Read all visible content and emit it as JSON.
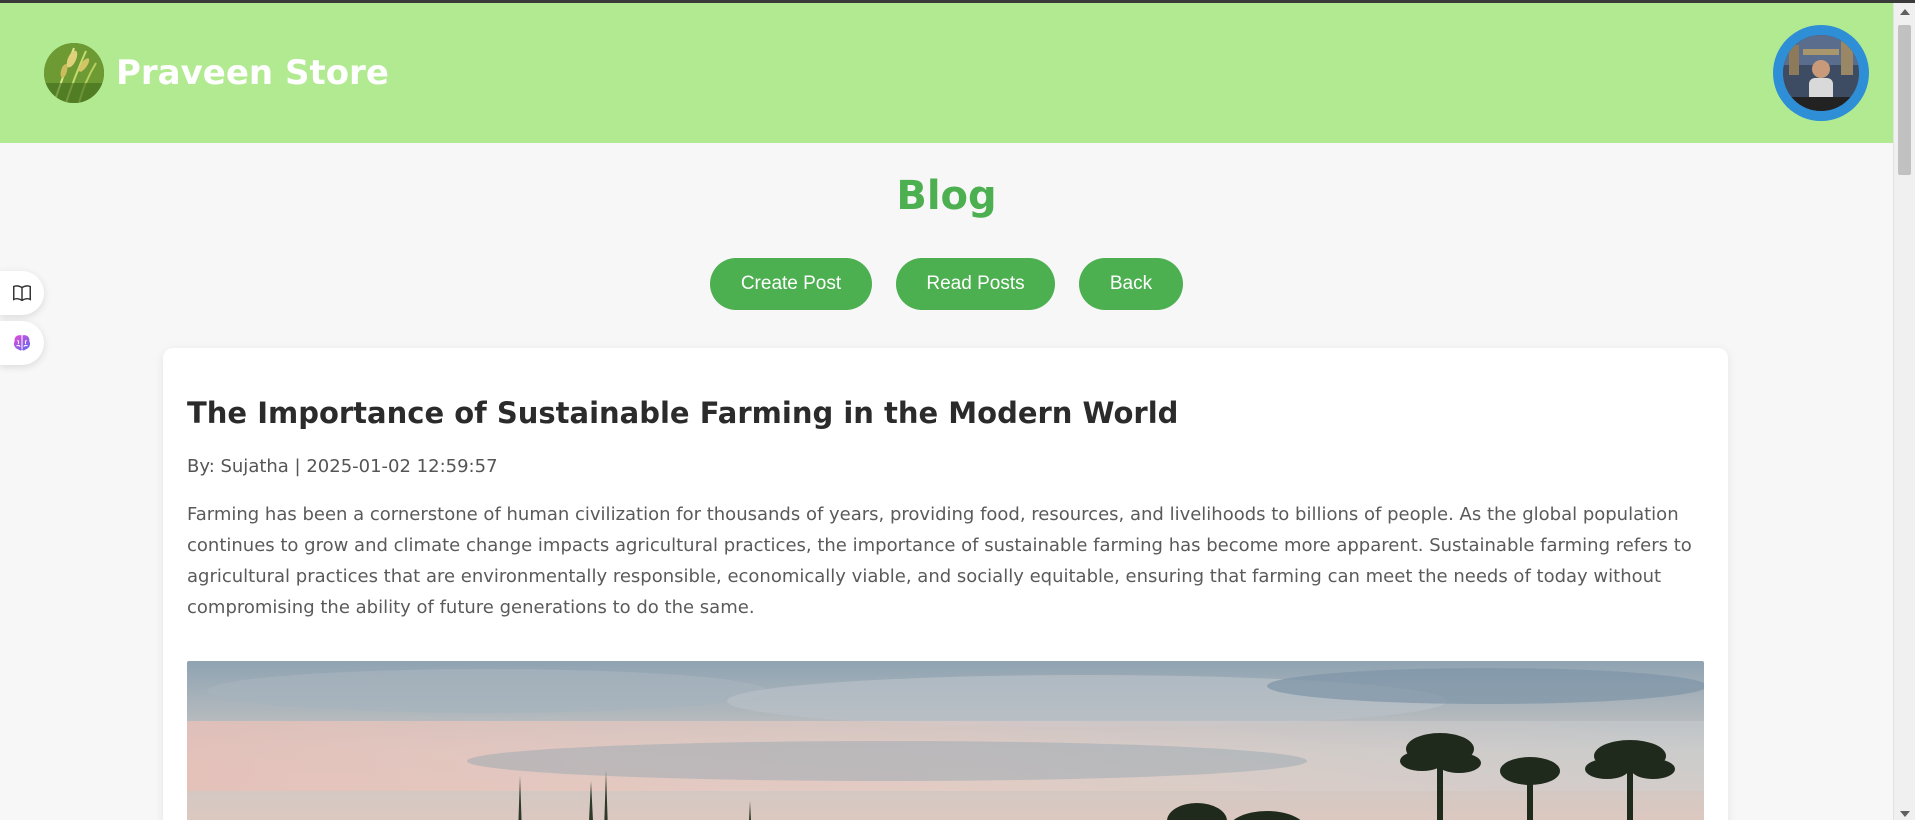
{
  "header": {
    "brand_name": "Praveen Store",
    "logo_icon": "rice-plant-logo",
    "avatar_icon": "user-avatar"
  },
  "page": {
    "title": "Blog"
  },
  "actions": {
    "create_label": "Create Post",
    "read_label": "Read Posts",
    "back_label": "Back"
  },
  "side_tools": [
    {
      "icon": "book-icon"
    },
    {
      "icon": "brain-icon"
    }
  ],
  "post": {
    "title": "The Importance of Sustainable Farming in the Modern World",
    "meta": "By: Sujatha | 2025-01-02 12:59:57",
    "body": "Farming has been a cornerstone of human civilization for thousands of years, providing food, resources, and livelihoods to billions of people. As the global population continues to grow and climate change impacts agricultural practices, the importance of sustainable farming has become more apparent. Sustainable farming refers to agricultural practices that are environmentally responsible, economically viable, and socially equitable, ensuring that farming can meet the needs of today without compromising the ability of future generations to do the same."
  },
  "colors": {
    "header_bg": "#b2ea92",
    "accent": "#4caf50",
    "avatar_ring": "#2e8fd6"
  }
}
